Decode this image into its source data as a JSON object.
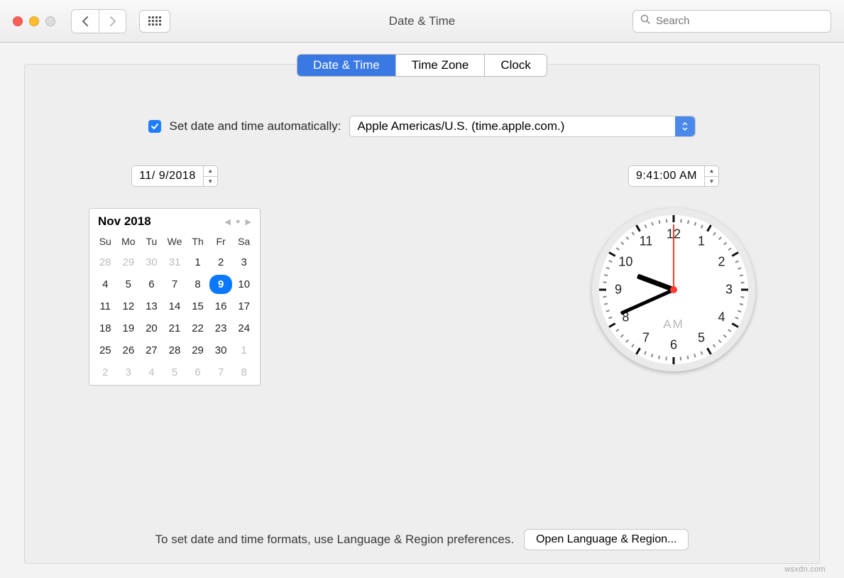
{
  "window": {
    "title": "Date & Time",
    "search_placeholder": "Search"
  },
  "tabs": {
    "items": [
      "Date & Time",
      "Time Zone",
      "Clock"
    ],
    "active": 0
  },
  "auto_datetime": {
    "checked": true,
    "label": "Set date and time automatically:",
    "server": "Apple Americas/U.S. (time.apple.com.)"
  },
  "date_field": {
    "value": "11/  9/2018"
  },
  "time_field": {
    "value": "9:41:00 AM"
  },
  "calendar": {
    "month_label": "Nov 2018",
    "dows": [
      "Su",
      "Mo",
      "Tu",
      "We",
      "Th",
      "Fr",
      "Sa"
    ],
    "days": [
      {
        "n": "28",
        "off": true
      },
      {
        "n": "29",
        "off": true
      },
      {
        "n": "30",
        "off": true
      },
      {
        "n": "31",
        "off": true
      },
      {
        "n": "1"
      },
      {
        "n": "2"
      },
      {
        "n": "3"
      },
      {
        "n": "4"
      },
      {
        "n": "5"
      },
      {
        "n": "6"
      },
      {
        "n": "7"
      },
      {
        "n": "8"
      },
      {
        "n": "9",
        "sel": true
      },
      {
        "n": "10"
      },
      {
        "n": "11"
      },
      {
        "n": "12"
      },
      {
        "n": "13"
      },
      {
        "n": "14"
      },
      {
        "n": "15"
      },
      {
        "n": "16"
      },
      {
        "n": "17"
      },
      {
        "n": "18"
      },
      {
        "n": "19"
      },
      {
        "n": "20"
      },
      {
        "n": "21"
      },
      {
        "n": "22"
      },
      {
        "n": "23"
      },
      {
        "n": "24"
      },
      {
        "n": "25"
      },
      {
        "n": "26"
      },
      {
        "n": "27"
      },
      {
        "n": "28"
      },
      {
        "n": "29"
      },
      {
        "n": "30"
      },
      {
        "n": "1",
        "off": true
      },
      {
        "n": "2",
        "off": true
      },
      {
        "n": "3",
        "off": true
      },
      {
        "n": "4",
        "off": true
      },
      {
        "n": "5",
        "off": true
      },
      {
        "n": "6",
        "off": true
      },
      {
        "n": "7",
        "off": true
      },
      {
        "n": "8",
        "off": true
      }
    ]
  },
  "clock": {
    "hour": 9,
    "minute": 41,
    "second": 0,
    "ampm": "AM",
    "numerals": [
      "12",
      "1",
      "2",
      "3",
      "4",
      "5",
      "6",
      "7",
      "8",
      "9",
      "10",
      "11"
    ]
  },
  "footer": {
    "hint": "To set date and time formats, use Language & Region preferences.",
    "button": "Open Language & Region..."
  },
  "watermark": "wsxdn.com"
}
